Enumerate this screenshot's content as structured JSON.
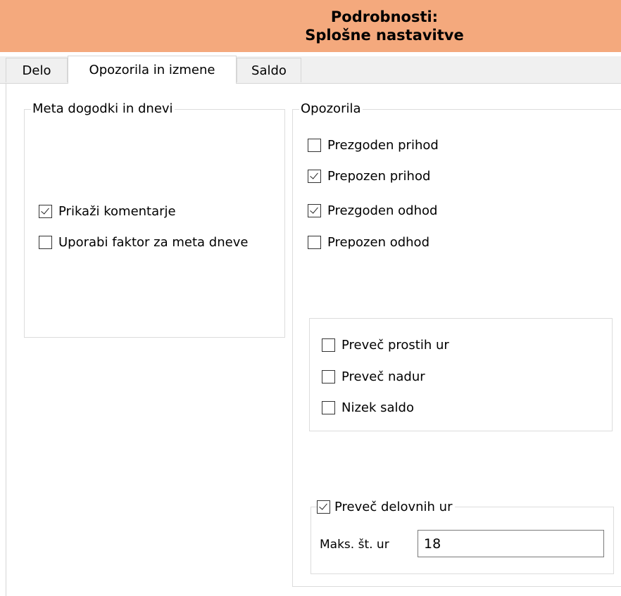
{
  "header": {
    "line1": "Podrobnosti:",
    "line2": "Splošne nastavitve",
    "background": "#f4a97d"
  },
  "tabs": [
    {
      "label": "Delo",
      "active": false
    },
    {
      "label": "Opozorila in izmene",
      "active": true
    },
    {
      "label": "Saldo",
      "active": false
    }
  ],
  "meta_group": {
    "title": "Meta dogodki in dnevi",
    "items": [
      {
        "label": "Prikaži komentarje",
        "checked": true
      },
      {
        "label": "Uporabi faktor za meta dneve",
        "checked": false
      }
    ]
  },
  "warnings_group": {
    "title": "Opozorila",
    "items": [
      {
        "label": "Prezgoden prihod",
        "checked": false
      },
      {
        "label": "Prepozen prihod",
        "checked": true
      },
      {
        "label": "Prezgoden odhod",
        "checked": true
      },
      {
        "label": "Prepozen odhod",
        "checked": false
      }
    ],
    "hours_items": [
      {
        "label": "Preveč prostih ur",
        "checked": false
      },
      {
        "label": "Preveč nadur",
        "checked": false
      },
      {
        "label": "Nizek saldo",
        "checked": false
      }
    ],
    "work_hours": {
      "title": "Preveč delovnih ur",
      "checked": true,
      "max_label": "Maks. št. ur",
      "max_value": "18"
    }
  }
}
